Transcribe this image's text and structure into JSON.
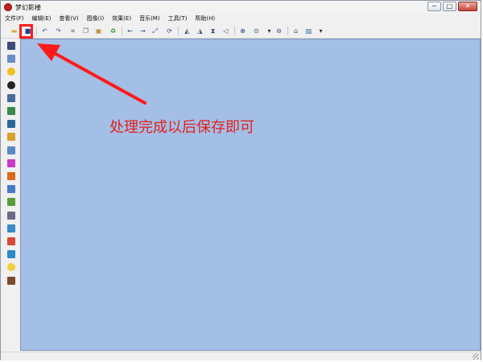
{
  "window": {
    "title": "梦幻影楼"
  },
  "window_controls": {
    "minimize": "─",
    "maximize": "□",
    "close": "✕"
  },
  "menu": [
    {
      "label": "文件(F)"
    },
    {
      "label": "编辑(E)"
    },
    {
      "label": "查看(V)"
    },
    {
      "label": "图像(I)"
    },
    {
      "label": "效果(E)"
    },
    {
      "label": "音乐(M)"
    },
    {
      "label": "工具(T)"
    },
    {
      "label": "帮助(H)"
    }
  ],
  "toolbar": [
    {
      "icon": "open-folder-icon",
      "glyph": "▬",
      "color": "#d9a93a"
    },
    {
      "icon": "save-icon",
      "glyph": "■",
      "color": "#1f3f8f"
    },
    {
      "icon": "undo-icon",
      "glyph": "↶",
      "color": "#3a5a9a"
    },
    {
      "icon": "redo-icon",
      "glyph": "↷",
      "color": "#3a5a9a"
    },
    {
      "icon": "crop-icon",
      "glyph": "⌗",
      "color": "#333333"
    },
    {
      "icon": "copy-icon",
      "glyph": "❐",
      "color": "#4a6a8a"
    },
    {
      "icon": "paste-icon",
      "glyph": "▣",
      "color": "#b58a2a"
    },
    {
      "icon": "recycle-icon",
      "glyph": "♻",
      "color": "#2a8a2a"
    },
    {
      "icon": "arrow-left-icon",
      "glyph": "←",
      "color": "#2a4a7a"
    },
    {
      "icon": "arrow-right-icon",
      "glyph": "→",
      "color": "#2a4a7a"
    },
    {
      "icon": "resize-icon",
      "glyph": "⤢",
      "color": "#2a4a7a"
    },
    {
      "icon": "rotate-icon",
      "glyph": "⟳",
      "color": "#2a4a7a"
    },
    {
      "icon": "flip-left-icon",
      "glyph": "◭",
      "color": "#2a4a7a"
    },
    {
      "icon": "flip-right-icon",
      "glyph": "◮",
      "color": "#2a4a7a"
    },
    {
      "icon": "mirror-icon",
      "glyph": "⧗",
      "color": "#2a4a7a"
    },
    {
      "icon": "triangle-icon",
      "glyph": "◁",
      "color": "#2a4a7a"
    },
    {
      "icon": "zoom-in-icon",
      "glyph": "⊕",
      "color": "#2a4a7a"
    },
    {
      "icon": "zoom-icon",
      "glyph": "⊙",
      "color": "#2a4a7a"
    },
    {
      "icon": "dropdown-arrow-icon",
      "glyph": "▾",
      "color": "#333333"
    },
    {
      "icon": "zoom-out-icon",
      "glyph": "⊖",
      "color": "#2a4a7a"
    },
    {
      "icon": "home-icon",
      "glyph": "⌂",
      "color": "#2a4a7a"
    },
    {
      "icon": "picture-icon",
      "glyph": "▨",
      "color": "#2a6aaa"
    },
    {
      "icon": "dropdown-arrow-icon",
      "glyph": "▾",
      "color": "#333333"
    }
  ],
  "sidebar": [
    {
      "icon": "select-tool-icon",
      "color": "#3b4a7a"
    },
    {
      "icon": "document-icon",
      "color": "#6a8ac8"
    },
    {
      "icon": "sun-icon",
      "color": "#f0c020"
    },
    {
      "icon": "contrast-icon",
      "color": "#222222"
    },
    {
      "icon": "brightness-icon",
      "color": "#4a6a9a"
    },
    {
      "icon": "landscape-icon",
      "color": "#3a8a4a"
    },
    {
      "icon": "photo-icon",
      "color": "#2a6a9a"
    },
    {
      "icon": "color-balance-icon",
      "color": "#d8a030"
    },
    {
      "icon": "frame-icon",
      "color": "#5a8ac8"
    },
    {
      "icon": "color-wheel-icon",
      "color": "#c83ac8"
    },
    {
      "icon": "sunset-icon",
      "color": "#d86a20"
    },
    {
      "icon": "filter-icon",
      "color": "#4a7ac8"
    },
    {
      "icon": "gradient-icon",
      "color": "#5a9a3a"
    },
    {
      "icon": "texture-icon",
      "color": "#6a6a8a"
    },
    {
      "icon": "pyramid-icon",
      "color": "#3a8ac8"
    },
    {
      "icon": "flowers-icon",
      "color": "#d84a3a"
    },
    {
      "icon": "grid-palette-icon",
      "color": "#2a8ac8"
    },
    {
      "icon": "lightbulb-icon",
      "color": "#f0d040"
    },
    {
      "icon": "face-icon",
      "color": "#7a4a2a"
    }
  ],
  "annotation": {
    "text": "处理完成以后保存即可",
    "color": "#e3201b"
  },
  "colors": {
    "canvas": "#a3bfe6",
    "highlight": "#ff1a1a",
    "arrow": "#ff1a1a"
  }
}
